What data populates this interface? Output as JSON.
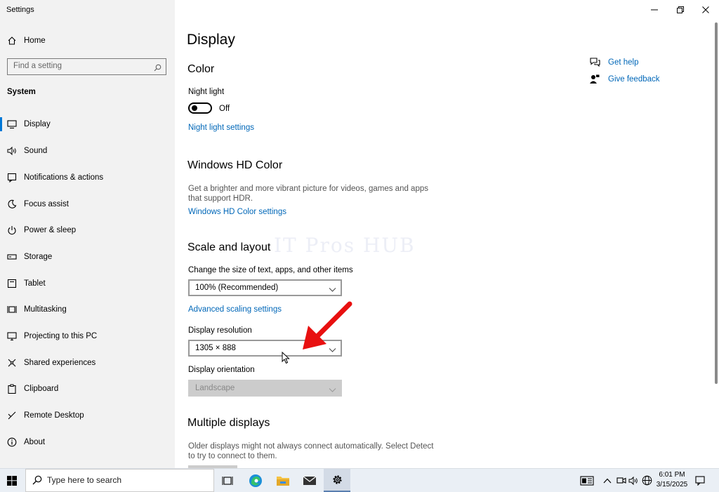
{
  "window": {
    "app_title": "Settings"
  },
  "sidebar": {
    "home_label": "Home",
    "search_placeholder": "Find a setting",
    "section_label": "System",
    "items": [
      {
        "label": "Display",
        "icon": "monitor-icon"
      },
      {
        "label": "Sound",
        "icon": "speaker-icon"
      },
      {
        "label": "Notifications & actions",
        "icon": "notification-icon"
      },
      {
        "label": "Focus assist",
        "icon": "moon-icon"
      },
      {
        "label": "Power & sleep",
        "icon": "power-icon"
      },
      {
        "label": "Storage",
        "icon": "drive-icon"
      },
      {
        "label": "Tablet",
        "icon": "tablet-icon"
      },
      {
        "label": "Multitasking",
        "icon": "multitasking-icon"
      },
      {
        "label": "Projecting to this PC",
        "icon": "projector-icon"
      },
      {
        "label": "Shared experiences",
        "icon": "shared-icon"
      },
      {
        "label": "Clipboard",
        "icon": "clipboard-icon"
      },
      {
        "label": "Remote Desktop",
        "icon": "remote-icon"
      },
      {
        "label": "About",
        "icon": "info-icon"
      }
    ]
  },
  "main": {
    "title": "Display",
    "color": {
      "heading": "Color",
      "night_light_label": "Night light",
      "night_light_state": "Off",
      "night_light_settings_link": "Night light settings"
    },
    "hdr": {
      "heading": "Windows HD Color",
      "description": "Get a brighter and more vibrant picture for videos, games and apps that support HDR.",
      "settings_link": "Windows HD Color settings"
    },
    "scale": {
      "heading": "Scale and layout",
      "size_label": "Change the size of text, apps, and other items",
      "size_value": "100% (Recommended)",
      "advanced_link": "Advanced scaling settings",
      "resolution_label": "Display resolution",
      "resolution_value": "1305 × 888",
      "orientation_label": "Display orientation",
      "orientation_value": "Landscape"
    },
    "multiple": {
      "heading": "Multiple displays",
      "description": "Older displays might not always connect automatically. Select Detect to try to connect to them."
    },
    "help": {
      "get_help": "Get help",
      "give_feedback": "Give feedback"
    },
    "watermark": "IT Pros HUB"
  },
  "taskbar": {
    "search_placeholder": "Type here to search",
    "time": "6:01 PM",
    "date": "3/15/2025"
  },
  "colors": {
    "accent": "#0078d7",
    "link": "#0067b8",
    "arrow": "#e81010"
  }
}
